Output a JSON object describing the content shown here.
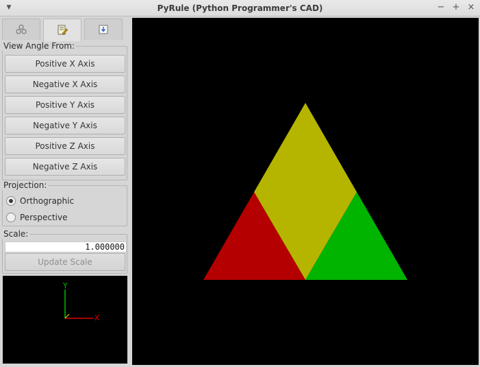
{
  "window": {
    "title": "PyRule (Python Programmer's CAD)"
  },
  "tabs": [
    {
      "icon": "molecule-icon"
    },
    {
      "icon": "document-edit-icon"
    },
    {
      "icon": "download-icon"
    }
  ],
  "view_angle": {
    "legend": "View Angle From:",
    "buttons": [
      "Positive X Axis",
      "Negative X Axis",
      "Positive Y Axis",
      "Negative Y Axis",
      "Positive Z Axis",
      "Negative Z Axis"
    ]
  },
  "projection": {
    "legend": "Projection:",
    "options": [
      "Orthographic",
      "Perspective"
    ],
    "selected": "Orthographic"
  },
  "scale": {
    "legend": "Scale:",
    "value": "1.000000",
    "update_label": "Update Scale"
  },
  "axes_preview": {
    "x_label": "X",
    "y_label": "Y"
  },
  "colors": {
    "yellow": "#b5b500",
    "red": "#b40000",
    "green": "#00b400",
    "x_axis": "#e00000",
    "y_axis": "#00c000"
  }
}
